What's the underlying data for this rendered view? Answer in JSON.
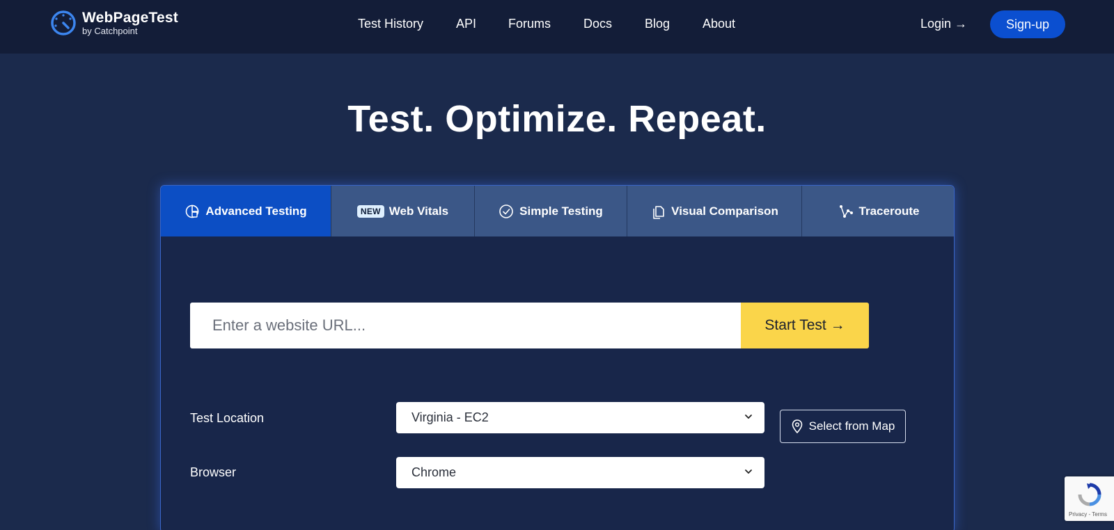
{
  "header": {
    "brand_title": "WebPageTest",
    "brand_subtitle": "by Catchpoint",
    "nav": [
      "Test History",
      "API",
      "Forums",
      "Docs",
      "Blog",
      "About"
    ],
    "login_label": "Login →",
    "signup_label": "Sign-up"
  },
  "hero": {
    "headline": "Test. Optimize. Repeat."
  },
  "tabs": {
    "advanced": "Advanced Testing",
    "new_badge": "NEW",
    "web_vitals": "Web Vitals",
    "simple": "Simple Testing",
    "visual": "Visual Comparison",
    "traceroute": "Traceroute",
    "active": "Advanced Testing"
  },
  "form": {
    "url_placeholder": "Enter a website URL...",
    "start_label": "Start Test →",
    "location_label": "Test Location",
    "location_value": "Virginia - EC2",
    "map_label": "Select from Map",
    "browser_label": "Browser",
    "browser_value": "Chrome"
  },
  "recaptcha": {
    "links": "Privacy - Terms"
  },
  "colors": {
    "page_bg": "#1b2a4c",
    "header_bg": "#131d38",
    "accent_blue": "#0b4fd0",
    "start_yellow": "#fad54a",
    "tab_bg": "#3b5787"
  }
}
